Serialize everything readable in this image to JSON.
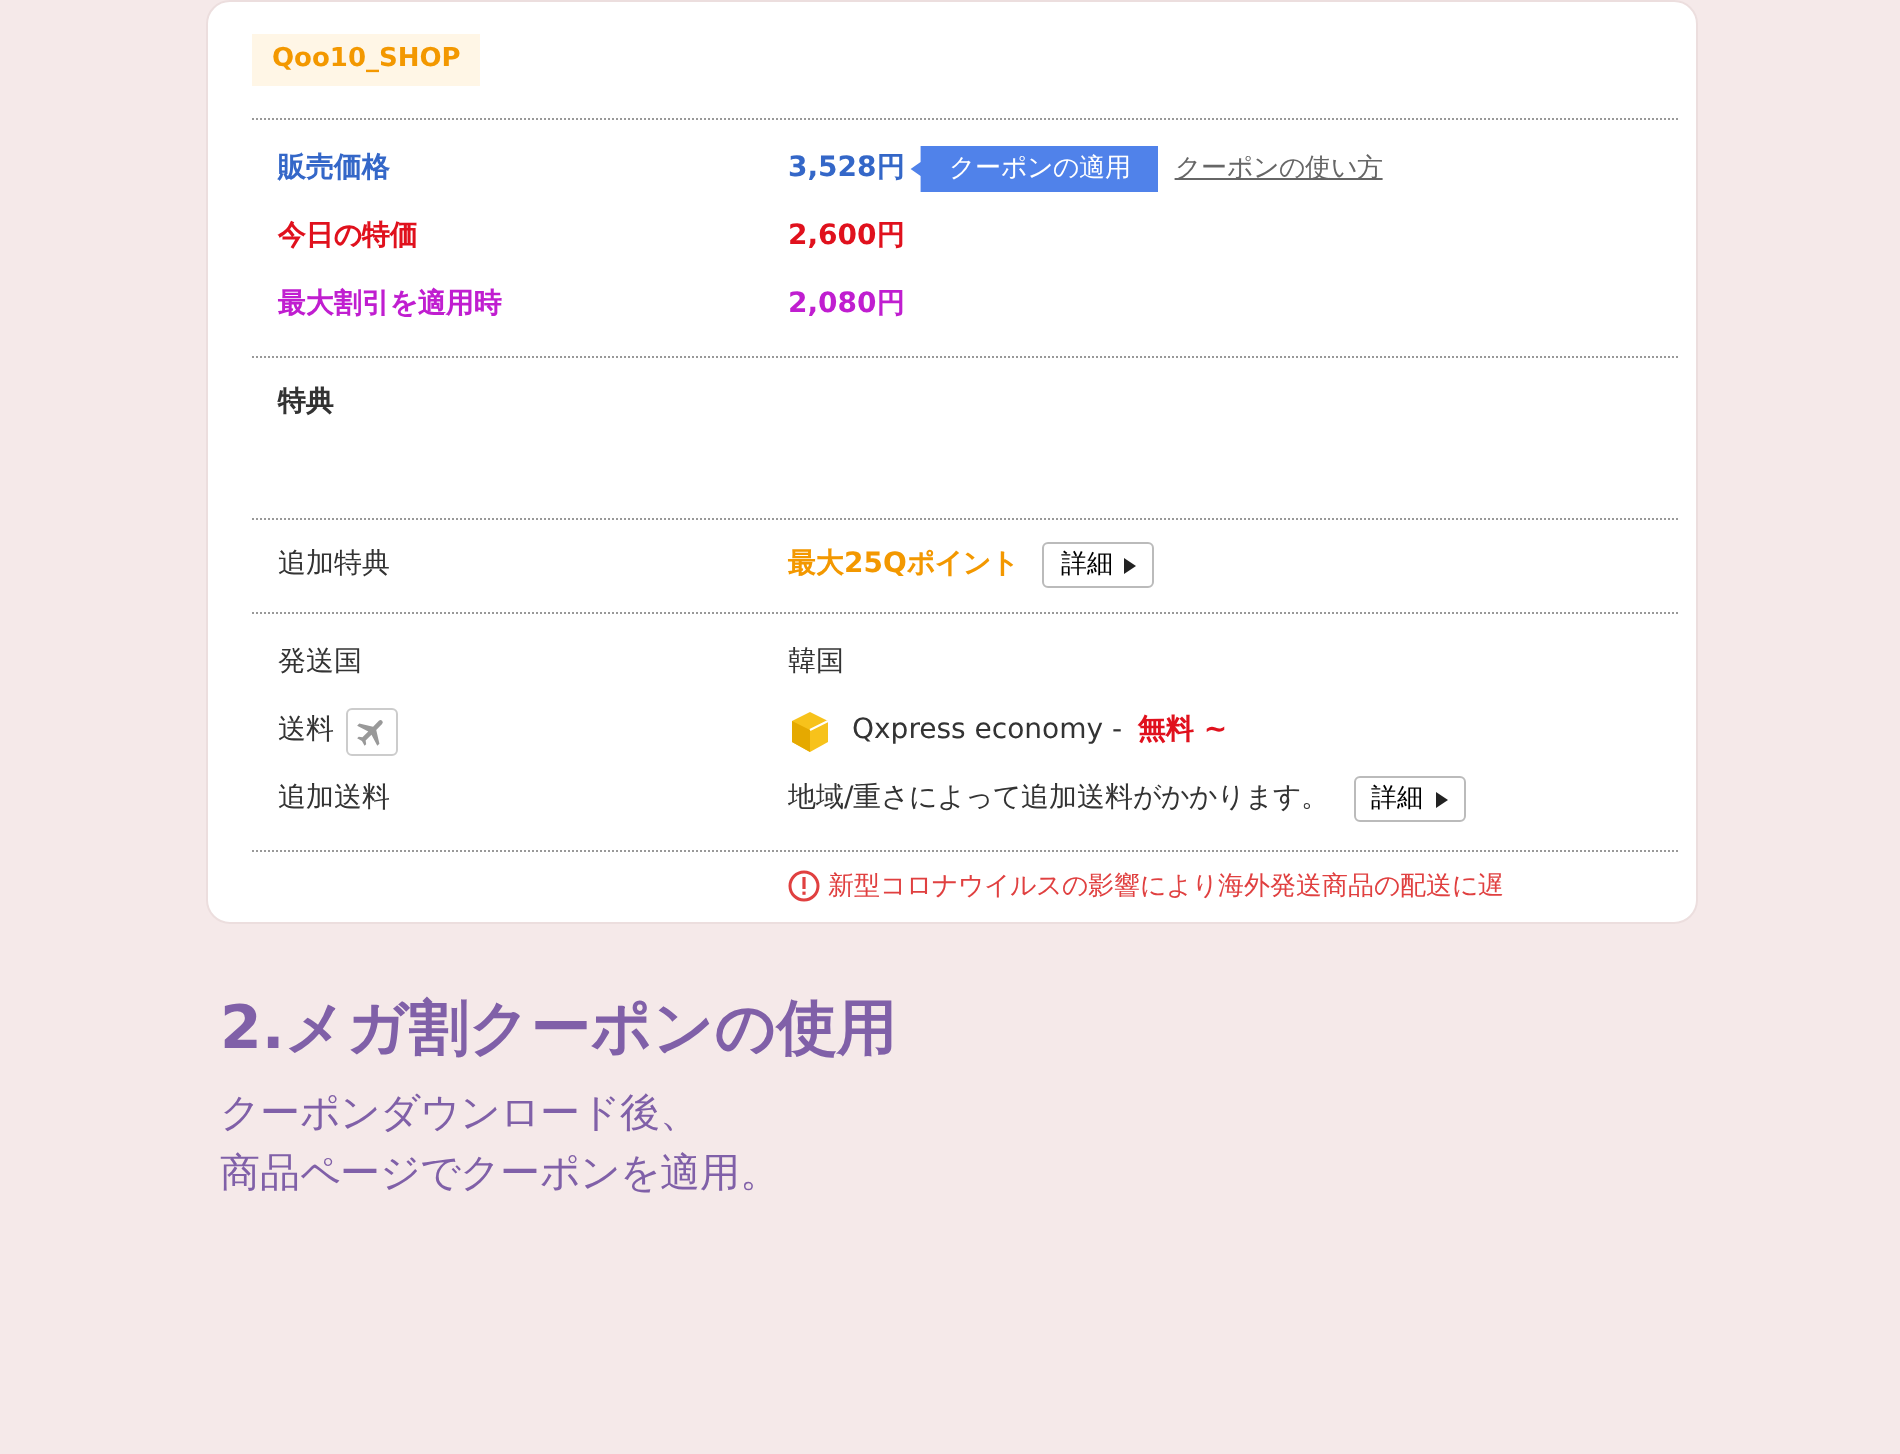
{
  "shop_label": "Qoo10_SHOP",
  "prices": [
    {
      "label": "販売価格",
      "value": "3,528円",
      "color": "#3467c8"
    },
    {
      "label": "今日の特価",
      "value": "2,600円",
      "color": "#e0111d"
    },
    {
      "label": "最大割引を適用時",
      "value": "2,080円",
      "color": "#c01ed0"
    }
  ],
  "coupon_button": "クーポンの適用",
  "coupon_link": "クーポンの使い方",
  "benefits_title": "特典",
  "extra_benefit": {
    "label": "追加特典",
    "value": "最大25Qポイント",
    "button": "詳細"
  },
  "shipping": [
    {
      "kind": "text",
      "label": "発送国",
      "value": "韓国"
    },
    {
      "kind": "method",
      "label": "送料",
      "method": "Qxpress economy -",
      "price": "無料 ~"
    },
    {
      "kind": "detail",
      "label": "追加送料",
      "value": "地域/重さによって追加送料がかかります。",
      "button": "詳細"
    }
  ],
  "notice": "新型コロナウイルスの影響により海外発送商品の配送に遅",
  "heading": "2.メガ割クーポンの使用",
  "description": [
    "クーポンダウンロード後、",
    "商品ページでクーポンを適用。"
  ]
}
